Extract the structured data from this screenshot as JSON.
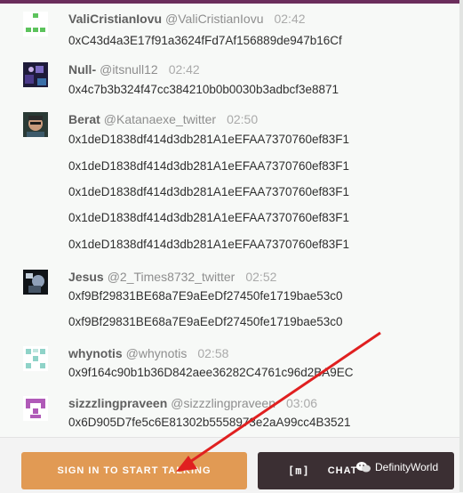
{
  "messages": [
    {
      "name": "ValiCristianIovu",
      "handle": "@ValiCristianIovu",
      "time": "02:42",
      "avatar": "identicon-green",
      "lines": [
        "0xC43d4a3E17f91a3624fFd7Af156889de947b16Cf"
      ]
    },
    {
      "name": "Null-",
      "handle": "@itsnull12",
      "time": "02:42",
      "avatar": "photo-avatar",
      "lines": [
        "0x4c7b3b324f47cc384210b0b0030b3adbcf3e8871"
      ]
    },
    {
      "name": "Berat",
      "handle": "@Katanaexe_twitter",
      "time": "02:50",
      "avatar": "photo-avatar",
      "lines": [
        "0x1deD1838df414d3db281A1eEFAA7370760ef83F1",
        "0x1deD1838df414d3db281A1eEFAA7370760ef83F1",
        "0x1deD1838df414d3db281A1eEFAA7370760ef83F1",
        "0x1deD1838df414d3db281A1eEFAA7370760ef83F1",
        "0x1deD1838df414d3db281A1eEFAA7370760ef83F1"
      ]
    },
    {
      "name": "Jesus",
      "handle": "@2_Times8732_twitter",
      "time": "02:52",
      "avatar": "photo-avatar",
      "lines": [
        "0xf9Bf29831BE68a7E9aEeDf27450fe1719bae53c0",
        "0xf9Bf29831BE68a7E9aEeDf27450fe1719bae53c0"
      ]
    },
    {
      "name": "whynotis",
      "handle": "@whynotis",
      "time": "02:58",
      "avatar": "identicon-teal",
      "lines": [
        "0x9f164c90b1b36D842aee36282C4761c96d2BA9EC"
      ]
    },
    {
      "name": "sizzzlingpraveen",
      "handle": "@sizzzlingpraveen",
      "time": "03:06",
      "avatar": "identicon-purple",
      "lines": [
        "0x6D905D7fe5c6E81302b5558973e2aA99cc4B3521"
      ]
    }
  ],
  "footer": {
    "signin_label": "SIGN IN TO START TALKING",
    "chat_label": "CHAT",
    "chat_icon": "[m]",
    "watermark_text": "DefinityWorld"
  },
  "colors": {
    "accent_orange": "#e19a54",
    "dark_button": "#3b2f33",
    "arrow_red": "#e02020"
  }
}
